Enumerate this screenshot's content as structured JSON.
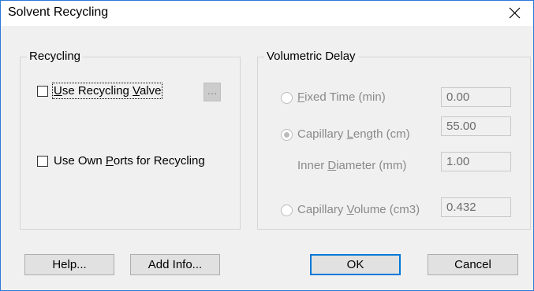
{
  "window": {
    "title": "Solvent Recycling",
    "close_icon": "close-icon"
  },
  "recycling": {
    "legend": "Recycling",
    "use_recycling_valve": {
      "prefix": "",
      "mnemonic": "U",
      "rest_before": "se Recycling ",
      "mnemonic2": "V",
      "suffix": "alve",
      "checked": false
    },
    "ellipsis_button": "...",
    "use_own_ports": {
      "before": "Use Own ",
      "mnemonic": "P",
      "after": "orts for Recycling",
      "checked": false
    }
  },
  "volumetric_delay": {
    "legend": "Volumetric Delay",
    "fixed_time": {
      "mnemonic": "F",
      "after": "ixed Time (min)",
      "value": "0.00",
      "selected": false
    },
    "capillary_length": {
      "before": "Capillary ",
      "mnemonic": "L",
      "after": "ength (cm)",
      "value": "55.00",
      "selected": true
    },
    "inner_diameter": {
      "before": "Inner ",
      "mnemonic": "D",
      "after": "iameter (mm)",
      "value": "1.00"
    },
    "capillary_volume": {
      "before": "Capillary ",
      "mnemonic": "V",
      "after": "olume (cm3)",
      "value": "0.432",
      "selected": false
    }
  },
  "buttons": {
    "help": "Help...",
    "add_info": "Add Info...",
    "ok": "OK",
    "cancel": "Cancel"
  },
  "colors": {
    "accent": "#0078d7",
    "window_border": "#2b79d8",
    "dialog_bg": "#f0f0f0",
    "disabled_text": "#8a8a8a"
  }
}
